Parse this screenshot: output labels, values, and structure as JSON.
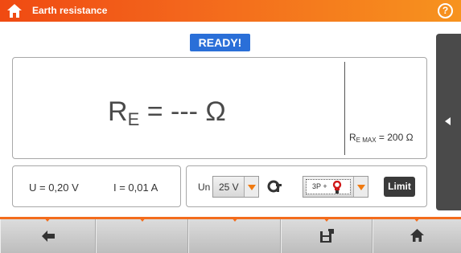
{
  "header": {
    "title": "Earth resistance",
    "home_icon": "home-icon",
    "help_icon": "help-icon",
    "help_label": "?"
  },
  "status": {
    "label": "READY!",
    "color": "#2a6fd8"
  },
  "result": {
    "symbol": "R",
    "subscript": "E",
    "rest": " = --- Ω",
    "rmax_symbol": "R",
    "rmax_subscript": "E MAX",
    "rmax_rest": " = 200 Ω"
  },
  "measurements": {
    "voltage": "U = 0,20 V",
    "current": "I = 0,01 A"
  },
  "settings": {
    "un_label": "Un",
    "un_value": "25 V",
    "clamp_icon": "clamp-icon",
    "mode_value": "3P +",
    "limit_label": "Limit"
  },
  "side_panel": {
    "icon": "left-arrow-icon"
  },
  "footer": {
    "buttons": [
      {
        "icon": "back-arrow-icon"
      },
      {
        "icon": ""
      },
      {
        "icon": ""
      },
      {
        "icon": "save-icon"
      },
      {
        "icon": "home-icon"
      }
    ]
  },
  "colors": {
    "accent": "#f36c1c",
    "dropdown_arrow": "#f07a10",
    "panel": "#4a4a4a"
  }
}
